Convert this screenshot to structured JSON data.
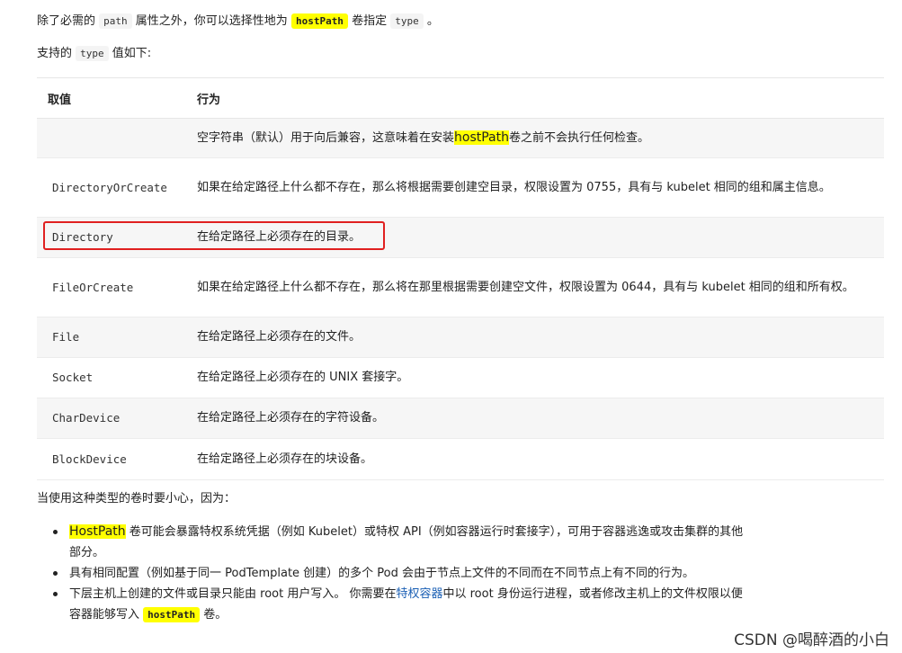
{
  "intro": {
    "p1_a": "除了必需的",
    "p1_code_path": "path",
    "p1_b": "属性之外，你可以选择性地为",
    "p1_code_hostpath": "hostPath",
    "p1_c": "卷指定",
    "p1_code_type": "type",
    "p1_d": "。",
    "p2_a": "支持的",
    "p2_code_type": "type",
    "p2_b": "值如下:"
  },
  "table": {
    "headers": [
      "取值",
      "行为"
    ],
    "rows": [
      {
        "value": "",
        "behavior_a": "空字符串（默认）用于向后兼容，这意味着在安装",
        "behavior_hl": "hostPath",
        "behavior_b": "卷之前不会执行任何检查。"
      },
      {
        "value": "DirectoryOrCreate",
        "behavior": "如果在给定路径上什么都不存在，那么将根据需要创建空目录，权限设置为 0755，具有与 kubelet 相同的组和属主信息。"
      },
      {
        "value": "Directory",
        "behavior": "在给定路径上必须存在的目录。"
      },
      {
        "value": "FileOrCreate",
        "behavior": "如果在给定路径上什么都不存在，那么将在那里根据需要创建空文件，权限设置为 0644，具有与 kubelet 相同的组和所有权。"
      },
      {
        "value": "File",
        "behavior": "在给定路径上必须存在的文件。"
      },
      {
        "value": "Socket",
        "behavior": "在给定路径上必须存在的 UNIX 套接字。"
      },
      {
        "value": "CharDevice",
        "behavior": "在给定路径上必须存在的字符设备。"
      },
      {
        "value": "BlockDevice",
        "behavior": "在给定路径上必须存在的块设备。"
      }
    ]
  },
  "caution": "当使用这种类型的卷时要小心，因为：",
  "notes": {
    "n1_hl": "HostPath",
    "n1_rest": "卷可能会暴露特权系统凭据（例如 Kubelet）或特权 API（例如容器运行时套接字），可用于容器逃逸或攻击集群的其他部分。",
    "n2": "具有相同配置（例如基于同一 PodTemplate 创建）的多个 Pod 会由于节点上文件的不同而在不同节点上有不同的行为。",
    "n3_a": "下层主机上创建的文件或目录只能由 root 用户写入。 你需要在",
    "n3_link": "特权容器",
    "n3_b": "中以 root 身份运行进程，或者修改主机上的文件权限以便容器能够写入",
    "n3_code": "hostPath",
    "n3_c": "卷。"
  },
  "watermark": "CSDN @喝醉酒的小白",
  "colors": {
    "highlight": "#ffff00",
    "annotation_box": "#e02020",
    "link": "#1a5fb4"
  }
}
